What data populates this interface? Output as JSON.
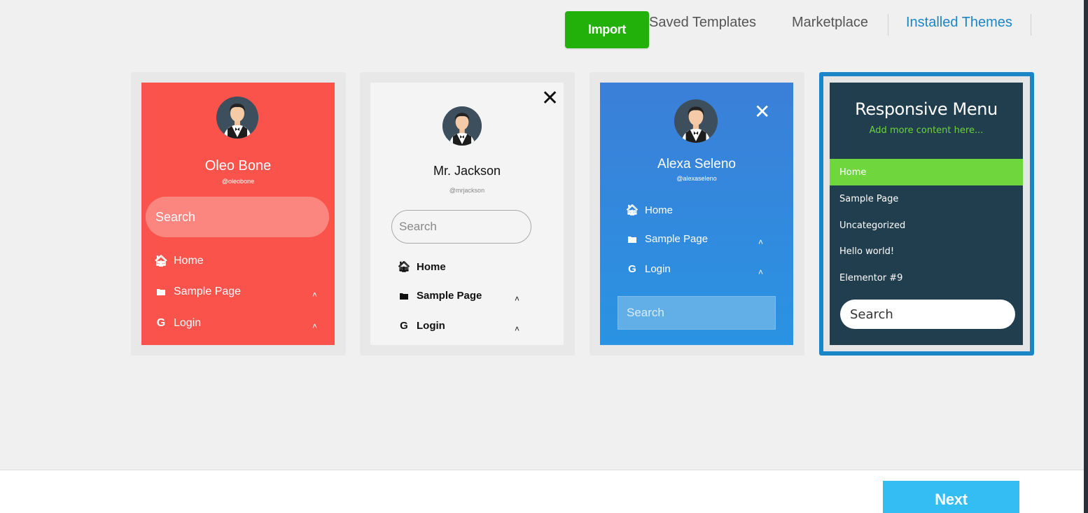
{
  "tabs": {
    "import_label": "Import",
    "saved_templates": "Saved Templates",
    "marketplace": "Marketplace",
    "installed_themes": "Installed Themes"
  },
  "colors": {
    "import_green": "#22b00a",
    "active_tab": "#1a86c7",
    "next_button": "#34bdf3",
    "theme_red": "#f9534c",
    "theme_blue": "#3b7fd8",
    "theme_dark": "#213e4f",
    "theme_dark_accent": "#6fd63e"
  },
  "themes": [
    {
      "name": "Oleo Bone",
      "handle": "@oleobone",
      "search_placeholder": "Search",
      "menu": [
        {
          "icon": "home-icon",
          "label": "Home"
        },
        {
          "icon": "folder-icon",
          "label": "Sample Page",
          "expandable": true
        },
        {
          "icon": "google-icon",
          "label": "Login",
          "expandable": true
        }
      ]
    },
    {
      "name": "Mr. Jackson",
      "handle": "@mrjackson",
      "search_placeholder": "Search",
      "menu": [
        {
          "icon": "home-icon",
          "label": "Home"
        },
        {
          "icon": "folder-icon",
          "label": "Sample Page",
          "expandable": true
        },
        {
          "icon": "google-icon",
          "label": "Login",
          "expandable": true
        }
      ]
    },
    {
      "name": "Alexa Seleno",
      "handle": "@alexaseleno",
      "search_placeholder": "Search",
      "menu": [
        {
          "icon": "home-icon",
          "label": "Home"
        },
        {
          "icon": "folder-icon",
          "label": "Sample Page",
          "expandable": true
        },
        {
          "icon": "google-icon",
          "label": "Login",
          "expandable": true
        }
      ]
    },
    {
      "title": "Responsive Menu",
      "subtitle": "Add more content here...",
      "selected": true,
      "search_placeholder": "Search",
      "menu": [
        {
          "label": "Home",
          "active": true
        },
        {
          "label": "Sample Page"
        },
        {
          "label": "Uncategorized"
        },
        {
          "label": "Hello world!"
        },
        {
          "label": "Elementor #9"
        }
      ]
    }
  ],
  "footer": {
    "next_label": "Next"
  }
}
